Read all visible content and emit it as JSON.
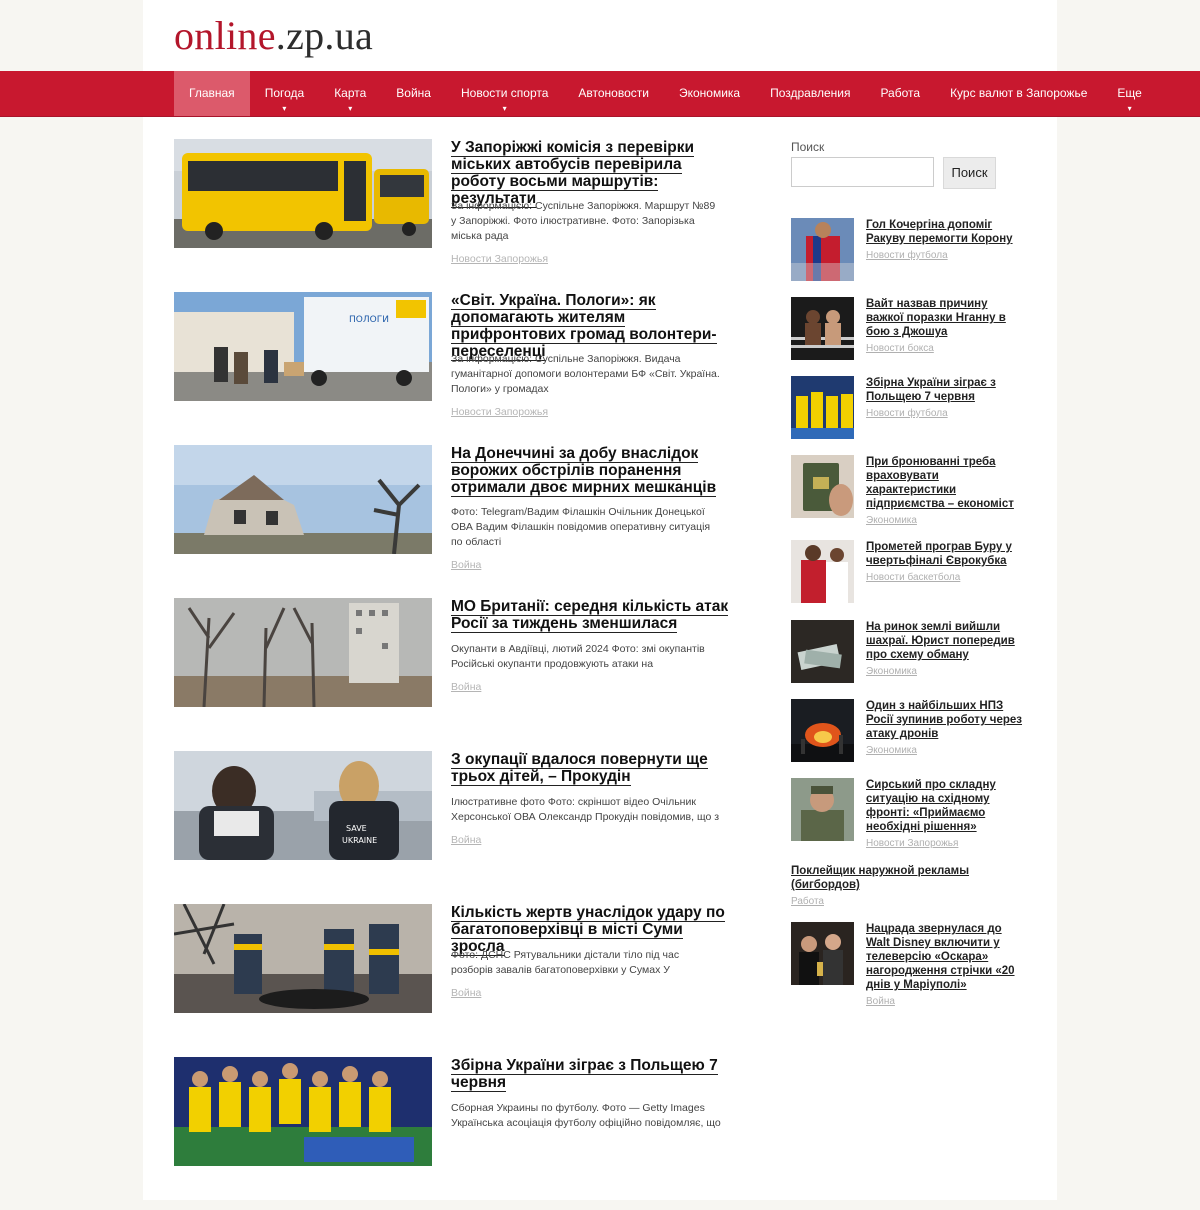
{
  "site": {
    "logo_part1": "online",
    "logo_part2": ".zp.ua"
  },
  "nav": {
    "items": [
      {
        "label": "Главная",
        "active": true,
        "has_dropdown": false
      },
      {
        "label": "Погода",
        "has_dropdown": true
      },
      {
        "label": "Карта",
        "has_dropdown": true
      },
      {
        "label": "Война",
        "has_dropdown": false
      },
      {
        "label": "Новости спорта",
        "has_dropdown": true
      },
      {
        "label": "Автоновости",
        "has_dropdown": false
      },
      {
        "label": "Экономика",
        "has_dropdown": false
      },
      {
        "label": "Поздравления",
        "has_dropdown": false
      },
      {
        "label": "Работа",
        "has_dropdown": false
      },
      {
        "label": "Курс валют в Запорожье",
        "has_dropdown": false
      },
      {
        "label": "Еще",
        "has_dropdown": true
      }
    ],
    "dropdown_arrow": "▾"
  },
  "articles": [
    {
      "title": "У Запоріжжі комісія з перевірки міських автобусів перевірила роботу восьми маршрутів: результати",
      "excerpt": "За інформацією: Суспільне Запоріжжя. Маршрут №89 у Запоріжжі. Фото ілюстративне. Фото: Запорізька міська рада",
      "category": "Новости Запорожья",
      "image": "yellow-buses"
    },
    {
      "title": "«Світ. Україна. Пологи»: як допомагають жителям прифронтових громад волонтери-переселенці",
      "excerpt": "За інформацією: Суспільне Запоріжжя. Видача гуманітарної допомоги волонтерами БФ «Світ. Україна. Пологи» у громадах",
      "category": "Новости Запорожья",
      "image": "aid-truck"
    },
    {
      "title": "На Донеччині за добу внаслідок ворожих обстрілів поранення отримали двоє мирних мешканців",
      "excerpt": "Фото: Telegram/Вадим Філашкін Очільник Донецької ОВА Вадим Філашкін повідомив оперативну ситуація по області",
      "category": "Война",
      "image": "destroyed-house"
    },
    {
      "title": "МО Британії: середня кількість атак Росії за тиждень зменшилася",
      "excerpt": "Окупанти в Авдіївці, лютий 2024 Фото: змі окупантів Російські окупанти продовжують атаки на",
      "category": "Война",
      "image": "ruined-city"
    },
    {
      "title": "З окупації вдалося повернути ще трьох дітей, – Прокудін",
      "excerpt": "Ілюстративне фото Фото: скріншот відео Очільник Херсонської ОВА Олександр Прокудін повідомив, що з",
      "category": "Война",
      "image": "save-ukraine-volunteers"
    },
    {
      "title": "Кількість жертв унаслідок удару по багатоповерхівці в місті Суми зросла",
      "excerpt": "Фото: ДСНС Рятувальники дістали тіло під час розборів завалів багатоповерхівки у Сумах У",
      "category": "Война",
      "image": "rescuers"
    },
    {
      "title": "Збірна України зіграє з Польщею 7 червня",
      "excerpt": "Сборная Украины по футболу. Фото — Getty Images Українська асоціація футболу офіційно повідомляє, що",
      "category": "",
      "image": "football-team"
    }
  ],
  "sidebar": {
    "search_label": "Поиск",
    "search_button": "Поиск",
    "search_value": "",
    "items": [
      {
        "title": "Гол Кочергіна допоміг Ракуву перемогти Корону",
        "category": "Новости футбола",
        "image": "footballer-red"
      },
      {
        "title": "Вайт назвав причину важкої поразки Нганну в бою з Джошуа",
        "category": "Новости бокса",
        "image": "boxing"
      },
      {
        "title": "Збірна України зіграє з Польщею 7 червня",
        "category": "Новости футбола",
        "image": "team-yellow"
      },
      {
        "title": "При бронюванні треба враховувати характеристики підприємства – економіст",
        "category": "Экономика",
        "image": "military-id"
      },
      {
        "title": "Прометей програв Буру у чвертьфіналі Єврокубка",
        "category": "Новости баскетбола",
        "image": "basketball"
      },
      {
        "title": "На ринок землі вийшли шахраї. Юрист попередив про схему обману",
        "category": "Экономика",
        "image": "money-soil"
      },
      {
        "title": "Один з найбільших НПЗ Росії зупинив роботу через атаку дронів",
        "category": "Экономика",
        "image": "refinery-fire"
      },
      {
        "title": "Сирський про складну ситуацію на східному фронті: «Приймаємо необхідні рішення»",
        "category": "Новости Запорожья",
        "image": "general"
      }
    ],
    "text_item": {
      "title": "Поклейщик наружной рекламы (бигбордов)",
      "category": "Работа"
    },
    "last_item": {
      "title": "Нацрада звернулася до Walt Disney включити у телеверсію «Оскара» нагородження стрічки «20 днів у Маріуполі»",
      "category": "Война",
      "image": "oscar-people"
    }
  },
  "colors": {
    "brand_red": "#c8182f",
    "nav_active": "#dc5a6b",
    "logo_red": "#b3162b",
    "category_grey": "#b5b5b5"
  }
}
